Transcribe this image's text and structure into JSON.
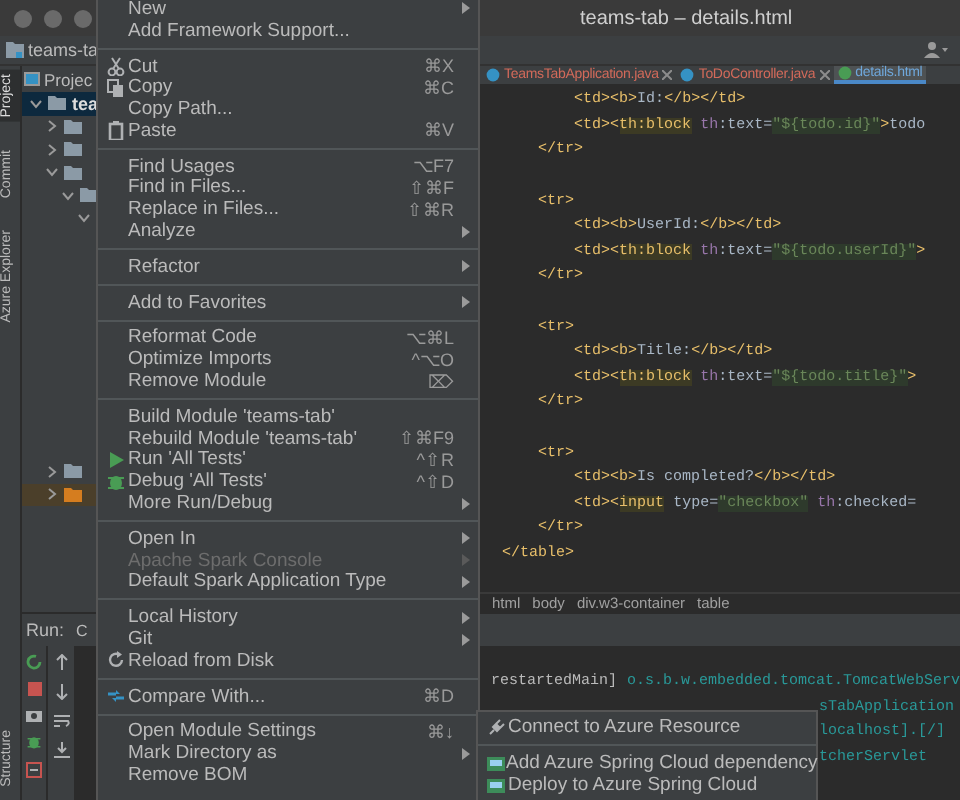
{
  "window": {
    "title": "teams-tab – details.html"
  },
  "toolbar": {
    "project_name": "teams-ta"
  },
  "side_tabs": [
    {
      "label": "Project",
      "selected": true
    },
    {
      "label": "Commit",
      "selected": false
    },
    {
      "label": "Azure Explorer",
      "selected": false
    }
  ],
  "bottom_side_tabs": [
    {
      "label": "Structure",
      "selected": false
    }
  ],
  "project_panel": {
    "title": "Projec",
    "tree": [
      {
        "label": "tea",
        "selected": true,
        "highlighted": false,
        "expanded": true,
        "children": [
          {
            "expanded": false,
            "selected": false,
            "highlighted": false
          },
          {
            "expanded": false,
            "selected": false,
            "highlighted": false
          },
          {
            "expanded": true,
            "selected": false,
            "highlighted": false,
            "children": [
              {
                "expanded": true,
                "selected": false,
                "highlighted": false,
                "children": [
                  {
                    "expanded": true,
                    "selected": false,
                    "highlighted": false
                  }
                ]
              }
            ]
          }
        ]
      }
    ],
    "tree_lower": [
      {
        "expanded": false,
        "selected": false,
        "highlighted": false
      },
      {
        "expanded": false,
        "selected": false,
        "highlighted": true
      }
    ]
  },
  "editor": {
    "tabs": [
      {
        "label": "TeamsTabApplication.java",
        "selected": false
      },
      {
        "label": "ToDoController.java",
        "selected": false
      },
      {
        "label": "details.html",
        "selected": true
      }
    ],
    "blocks": [
      [
        "        <td><b>Id:</b></td>",
        "        <td><th:block th:text=\"${todo.id}\">todo",
        "    </tr>"
      ],
      [
        "    <tr>",
        "        <td><b>UserId:</b></td>",
        "        <td><th:block th:text=\"${todo.userId}\">",
        "    </tr>"
      ],
      [
        "    <tr>",
        "        <td><b>Title:</b></td>",
        "        <td><th:block th:text=\"${todo.title}\">",
        "    </tr>"
      ],
      [
        "    <tr>",
        "        <td><b>Is completed?</b></td>",
        "        <td><input type=\"checkbox\" th:checked=",
        "    </tr>",
        "</table>"
      ]
    ],
    "breadcrumbs": [
      "html",
      "body",
      "div.w3-container",
      "table"
    ]
  },
  "run_panel": {
    "label": "Run:",
    "tab": "C",
    "console": [
      {
        "thread": "restartedMain]",
        "logger": "o.s.b.w.embedded.tomcat.TomcatWebServ"
      },
      {
        "logger": "sTabApplication"
      },
      {
        "logger": "localhost].[/]"
      },
      {
        "logger": "tcherServlet"
      }
    ]
  },
  "context_menu": [
    {
      "kind": "item",
      "label": "New",
      "submenu": true,
      "disabled": false
    },
    {
      "kind": "item",
      "label": "Add Framework Support...",
      "submenu": false,
      "disabled": false
    },
    {
      "kind": "separator"
    },
    {
      "kind": "item",
      "label": "Cut",
      "shortcut": "⌘X",
      "submenu": false,
      "disabled": false
    },
    {
      "kind": "item",
      "label": "Copy",
      "shortcut": "⌘C",
      "submenu": false,
      "disabled": false
    },
    {
      "kind": "item",
      "label": "Copy Path...",
      "submenu": false,
      "disabled": false
    },
    {
      "kind": "item",
      "label": "Paste",
      "shortcut": "⌘V",
      "submenu": false,
      "disabled": false
    },
    {
      "kind": "separator"
    },
    {
      "kind": "item",
      "label": "Find Usages",
      "shortcut": "⌥F7",
      "submenu": false,
      "disabled": false
    },
    {
      "kind": "item",
      "label": "Find in Files...",
      "shortcut": "⇧⌘F",
      "submenu": false,
      "disabled": false
    },
    {
      "kind": "item",
      "label": "Replace in Files...",
      "shortcut": "⇧⌘R",
      "submenu": false,
      "disabled": false
    },
    {
      "kind": "item",
      "label": "Analyze",
      "submenu": true,
      "disabled": false
    },
    {
      "kind": "separator"
    },
    {
      "kind": "item",
      "label": "Refactor",
      "submenu": true,
      "disabled": false
    },
    {
      "kind": "separator"
    },
    {
      "kind": "item",
      "label": "Add to Favorites",
      "submenu": true,
      "disabled": false
    },
    {
      "kind": "separator"
    },
    {
      "kind": "item",
      "label": "Reformat Code",
      "shortcut": "⌥⌘L",
      "submenu": false,
      "disabled": false
    },
    {
      "kind": "item",
      "label": "Optimize Imports",
      "shortcut": "^⌥O",
      "submenu": false,
      "disabled": false
    },
    {
      "kind": "item",
      "label": "Remove Module",
      "shortcut": "⌦",
      "submenu": false,
      "disabled": false
    },
    {
      "kind": "separator"
    },
    {
      "kind": "item",
      "label": "Build Module 'teams-tab'",
      "submenu": false,
      "disabled": false
    },
    {
      "kind": "item",
      "label": "Rebuild Module 'teams-tab'",
      "shortcut": "⇧⌘F9",
      "submenu": false,
      "disabled": false
    },
    {
      "kind": "item",
      "label": "Run 'All Tests'",
      "shortcut": "^⇧R",
      "submenu": false,
      "disabled": false
    },
    {
      "kind": "item",
      "label": "Debug 'All Tests'",
      "shortcut": "^⇧D",
      "submenu": false,
      "disabled": false
    },
    {
      "kind": "item",
      "label": "More Run/Debug",
      "submenu": true,
      "disabled": false
    },
    {
      "kind": "separator"
    },
    {
      "kind": "item",
      "label": "Open In",
      "submenu": true,
      "disabled": false
    },
    {
      "kind": "item",
      "label": "Apache Spark Console",
      "submenu": true,
      "disabled": true
    },
    {
      "kind": "item",
      "label": "Default Spark Application Type",
      "submenu": true,
      "disabled": false
    },
    {
      "kind": "separator"
    },
    {
      "kind": "item",
      "label": "Local History",
      "submenu": true,
      "disabled": false
    },
    {
      "kind": "item",
      "label": "Git",
      "submenu": true,
      "disabled": false
    },
    {
      "kind": "item",
      "label": "Reload from Disk",
      "submenu": false,
      "disabled": false
    },
    {
      "kind": "separator"
    },
    {
      "kind": "item",
      "label": "Compare With...",
      "shortcut": "⌘D",
      "submenu": false,
      "disabled": false
    },
    {
      "kind": "separator"
    },
    {
      "kind": "item",
      "label": "Open Module Settings",
      "shortcut": "⌘↓",
      "submenu": false,
      "disabled": false
    },
    {
      "kind": "item",
      "label": "Mark Directory as",
      "submenu": true,
      "disabled": false
    },
    {
      "kind": "item",
      "label": "Remove BOM",
      "submenu": false,
      "disabled": false
    }
  ],
  "azure_submenu": [
    {
      "kind": "item",
      "label": "Connect to Azure Resource"
    },
    {
      "kind": "separator"
    },
    {
      "kind": "item",
      "label": "Add Azure Spring Cloud dependency"
    },
    {
      "kind": "item",
      "label": "Deploy to Azure Spring Cloud"
    }
  ]
}
